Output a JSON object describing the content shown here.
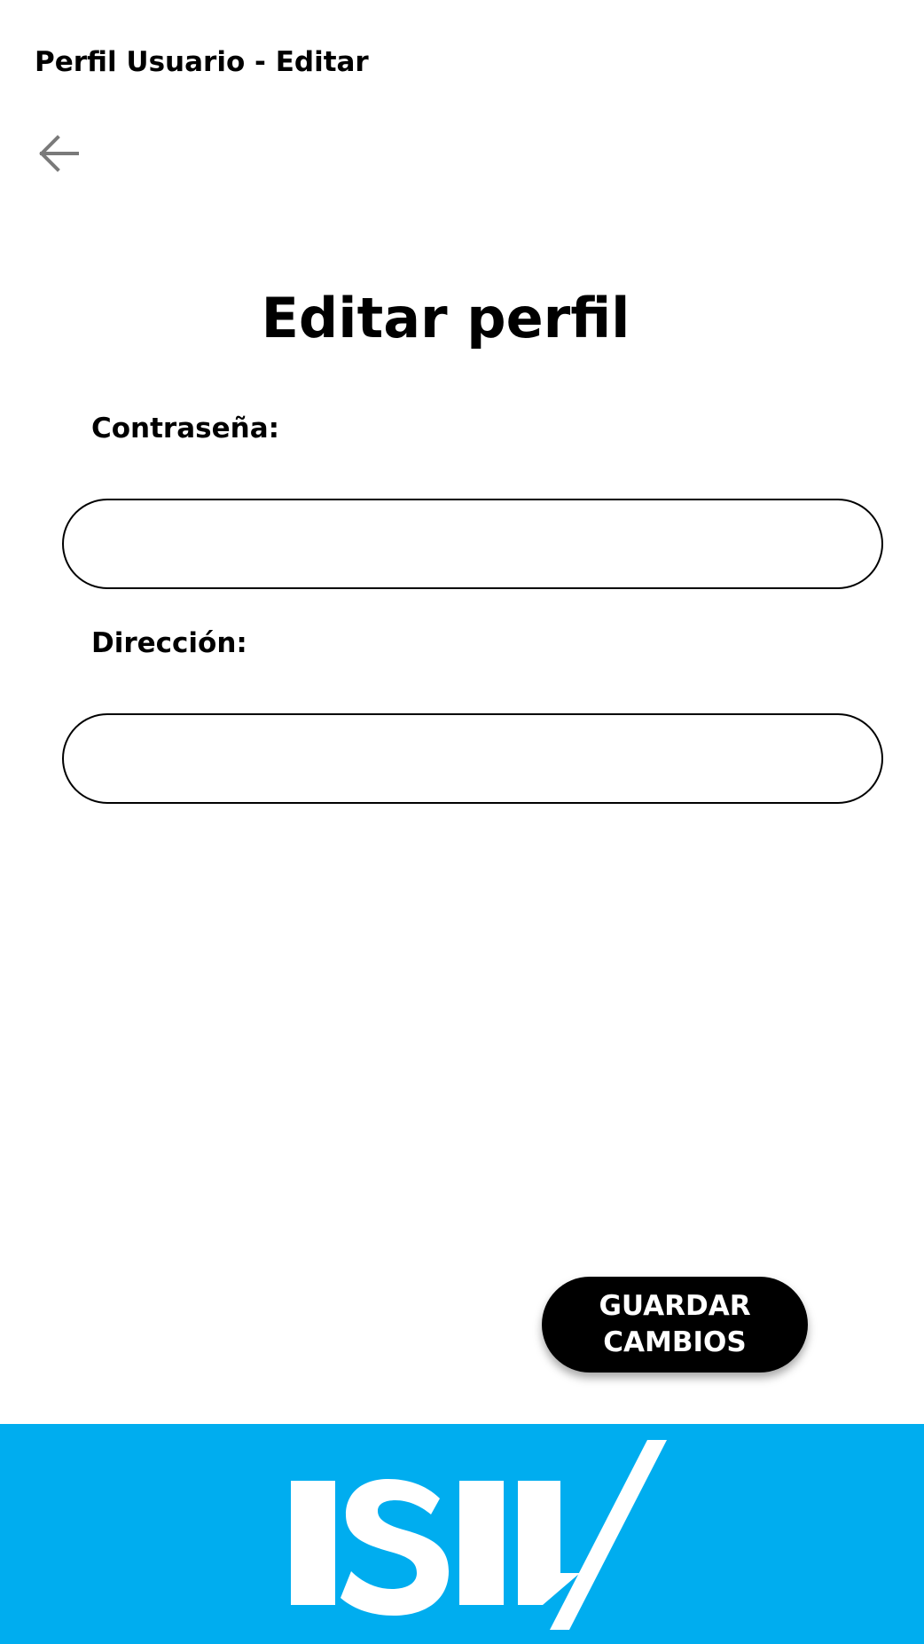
{
  "header": {
    "window_title": "Perfil Usuario - Editar",
    "back_icon": "arrow-left-icon"
  },
  "main": {
    "title": "Editar perfil",
    "fields": [
      {
        "label": "Contraseña:",
        "value": "",
        "placeholder": ""
      },
      {
        "label": "Dirección:",
        "value": "",
        "placeholder": ""
      }
    ],
    "save_button": {
      "line1": "GUARDAR",
      "line2": "CAMBIOS"
    }
  },
  "footer": {
    "logo_text": "ISIL",
    "color": "#00adef"
  },
  "colors": {
    "background": "#ffffff",
    "text": "#000000",
    "button": "#000000",
    "button_text": "#ffffff",
    "brand": "#00adef"
  }
}
